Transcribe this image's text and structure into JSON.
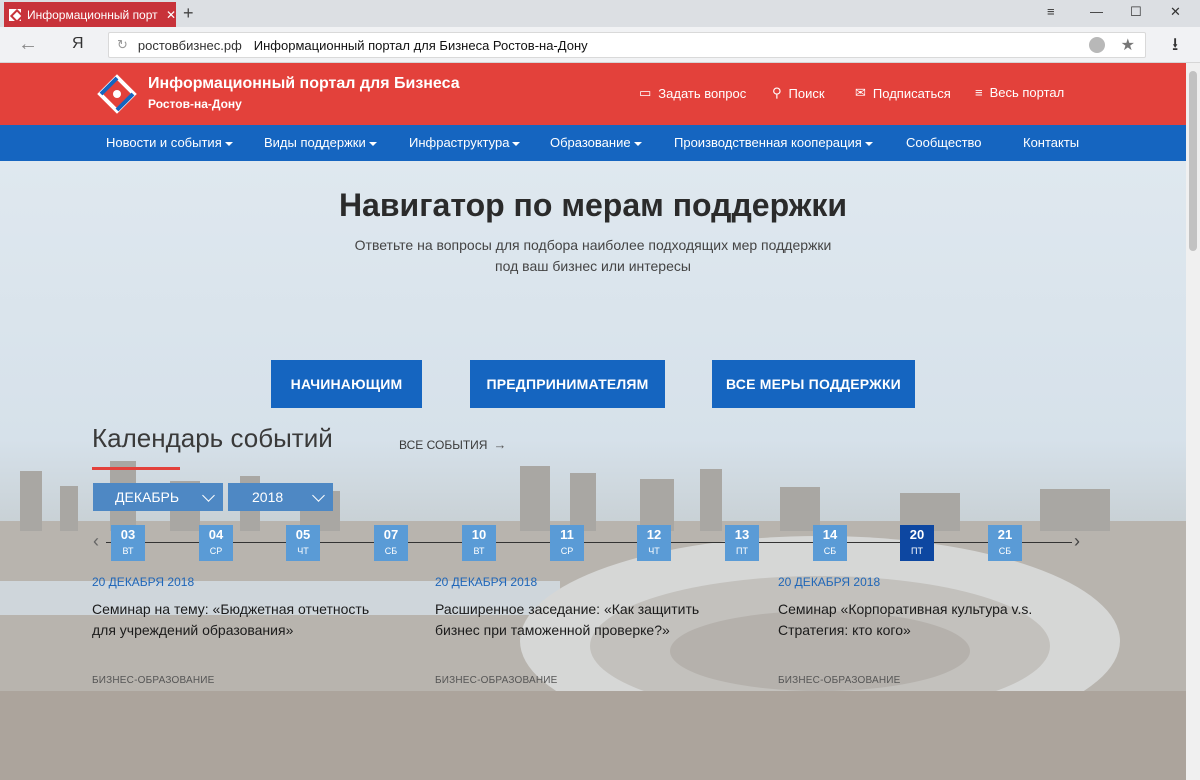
{
  "browser": {
    "tab_title": "Информационный порт",
    "new_tab": "+",
    "back": "←",
    "ya": "Я",
    "url_host": "ростовбизнес.рф",
    "url_title": "Информационный портал для Бизнеса Ростов-на-Дону",
    "minimize": "—",
    "maximize": "☐",
    "close": "✕",
    "menu": "≡",
    "download": "⭳",
    "star": "★"
  },
  "header": {
    "brand_title": "Информационный портал для Бизнеса",
    "brand_sub": "Ростов-на-Дону",
    "ask": "Задать вопрос",
    "search": "Поиск",
    "subscribe": "Подписаться",
    "portal": "Весь портал",
    "colors": {
      "red": "#e3413b",
      "blue": "#1565c0"
    }
  },
  "nav": [
    {
      "label": "Новости и события",
      "dropdown": true
    },
    {
      "label": "Виды поддержки",
      "dropdown": true
    },
    {
      "label": "Инфраструктура",
      "dropdown": true
    },
    {
      "label": "Образование",
      "dropdown": true
    },
    {
      "label": "Производственная кооперация",
      "dropdown": true
    },
    {
      "label": "Сообщество",
      "dropdown": false
    },
    {
      "label": "Контакты",
      "dropdown": false
    }
  ],
  "hero": {
    "title": "Навигатор по мерам поддержки",
    "subtitle": "Ответьте на вопросы для подбора наиболее подходящих мер поддержки под ваш бизнес или интересы",
    "buttons": [
      "НАЧИНАЮЩИМ",
      "ПРЕДПРИНИМАТЕЛЯМ",
      "ВСЕ МЕРЫ ПОДДЕРЖКИ"
    ]
  },
  "calendar": {
    "title": "Календарь событий",
    "all_events": "ВСЕ СОБЫТИЯ",
    "month": "ДЕКАБРЬ",
    "year": "2018",
    "days": [
      {
        "num": "03",
        "dow": "ВТ"
      },
      {
        "num": "04",
        "dow": "СР"
      },
      {
        "num": "05",
        "dow": "ЧТ"
      },
      {
        "num": "07",
        "dow": "СБ"
      },
      {
        "num": "10",
        "dow": "ВТ"
      },
      {
        "num": "11",
        "dow": "СР"
      },
      {
        "num": "12",
        "dow": "ЧТ"
      },
      {
        "num": "13",
        "dow": "ПТ"
      },
      {
        "num": "14",
        "dow": "СБ"
      },
      {
        "num": "20",
        "dow": "ПТ",
        "active": true
      },
      {
        "num": "21",
        "dow": "СБ"
      }
    ],
    "events": [
      {
        "date": "20 ДЕКАБРЯ 2018",
        "title": "Семинар на тему: «Бюджетная отчетность для учреждений образования»",
        "tag": "БИЗНЕС-ОБРАЗОВАНИЕ"
      },
      {
        "date": "20 ДЕКАБРЯ 2018",
        "title": "Расширенное заседание: «Как защитить бизнес при таможенной проверке?»",
        "tag": "БИЗНЕС-ОБРАЗОВАНИЕ"
      },
      {
        "date": "20 ДЕКАБРЯ 2018",
        "title": "Семинар «Корпоративная культура v.s. Стратегия: кто кого»",
        "tag": "БИЗНЕС-ОБРАЗОВАНИЕ"
      }
    ]
  }
}
